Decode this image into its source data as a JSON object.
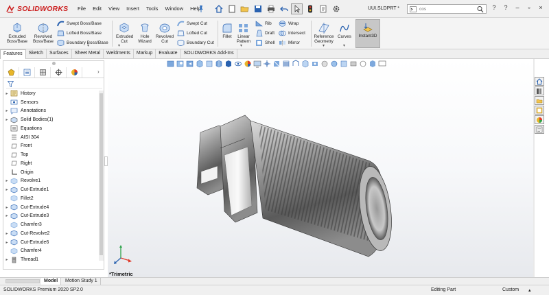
{
  "app": {
    "brand": "SOLIDWORKS",
    "document_name": "UUI.SLDPRT *",
    "colors": {
      "brand_red": "#cc1f1f",
      "ribbon_bg": "#f4f4f4",
      "instant3d_bg": "#c7c7c7"
    }
  },
  "menu": [
    "File",
    "Edit",
    "View",
    "Insert",
    "Tools",
    "Window",
    "Help"
  ],
  "search": {
    "value": "cos"
  },
  "window_controls": [
    "?",
    "?",
    "–",
    "▫",
    "×"
  ],
  "ribbon": {
    "extruded_boss": "Extruded Boss/Base",
    "revolved_boss": "Revolved Boss/Base",
    "swept_boss": "Swept Boss/Base",
    "lofted_boss": "Lofted Boss/Base",
    "boundary_boss": "Boundary Boss/Base",
    "extruded_cut": "Extruded Cut",
    "hole_wizard": "Hole Wizard",
    "revolved_cut": "Revolved Cut",
    "swept_cut": "Swept Cut",
    "lofted_cut": "Lofted Cut",
    "boundary_cut": "Boundary Cut",
    "fillet": "Fillet",
    "linear_pattern": "Linear Pattern",
    "rib": "Rib",
    "draft": "Draft",
    "shell": "Shell",
    "wrap": "Wrap",
    "intersect": "Intersect",
    "mirror": "Mirror",
    "reference_geometry": "Reference Geometry",
    "curves": "Curves",
    "instant3d": "Instant3D"
  },
  "tabs": [
    "Features",
    "Sketch",
    "Surfaces",
    "Sheet Metal",
    "Weldments",
    "Markup",
    "Evaluate",
    "SOLIDWORKS Add-Ins"
  ],
  "tree": [
    {
      "label": "History",
      "arrow": "▸",
      "icon": "history-icon"
    },
    {
      "label": "Sensors",
      "arrow": "",
      "icon": "sensors-icon"
    },
    {
      "label": "Annotations",
      "arrow": "▸",
      "icon": "annotations-icon"
    },
    {
      "label": "Solid Bodies(1)",
      "arrow": "▸",
      "icon": "solid-bodies-icon"
    },
    {
      "label": "Equations",
      "arrow": "",
      "icon": "equations-icon"
    },
    {
      "label": "AISI 304",
      "arrow": "",
      "icon": "material-icon"
    },
    {
      "label": "Front",
      "arrow": "",
      "icon": "plane-icon"
    },
    {
      "label": "Top",
      "arrow": "",
      "icon": "plane-icon"
    },
    {
      "label": "Right",
      "arrow": "",
      "icon": "plane-icon"
    },
    {
      "label": "Origin",
      "arrow": "",
      "icon": "origin-icon"
    },
    {
      "label": "Revolve1",
      "arrow": "▸",
      "icon": "revolve-icon"
    },
    {
      "label": "Cut-Extrude1",
      "arrow": "▸",
      "icon": "cut-extrude-icon"
    },
    {
      "label": "Fillet2",
      "arrow": "",
      "icon": "fillet-icon"
    },
    {
      "label": "Cut-Extrude4",
      "arrow": "▸",
      "icon": "cut-extrude-icon"
    },
    {
      "label": "Cut-Extrude3",
      "arrow": "▸",
      "icon": "cut-extrude-icon"
    },
    {
      "label": "Chamfer3",
      "arrow": "",
      "icon": "chamfer-icon"
    },
    {
      "label": "Cut-Revolve2",
      "arrow": "▸",
      "icon": "cut-revolve-icon"
    },
    {
      "label": "Cut-Extrude6",
      "arrow": "▸",
      "icon": "cut-extrude-icon"
    },
    {
      "label": "Chamfer4",
      "arrow": "",
      "icon": "chamfer-icon"
    },
    {
      "label": "Thread1",
      "arrow": "▸",
      "icon": "thread-icon"
    }
  ],
  "viewport": {
    "view_orientation": "*Trimetric"
  },
  "bottom_tabs": [
    "Model",
    "Motion Study 1"
  ],
  "status": {
    "product": "SOLIDWORKS Premium 2020 SP2.0",
    "mode": "Editing Part",
    "units": "Custom",
    "caret": "▴"
  }
}
